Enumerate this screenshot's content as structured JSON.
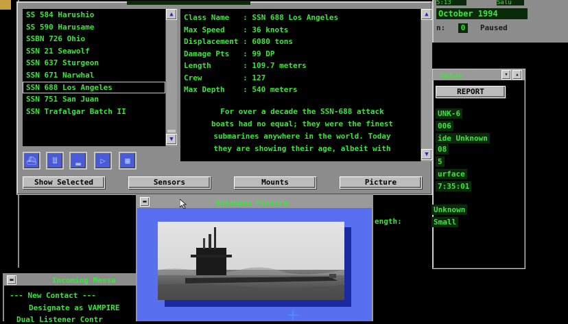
{
  "top_right": {
    "date": "October 1994",
    "speed_label": "n:",
    "speed_value": "0",
    "status": "Paused",
    "partial_time": "5:13",
    "partial_text": "Salu"
  },
  "database": {
    "ship_list": [
      "SS 584 Harushio",
      "SS 590 Harusame",
      "SSBN 726 Ohio",
      "SSN 21 Seawolf",
      "SSN 637 Sturgeon",
      "SSN 671 Narwhal",
      "SSN 688 Los Angeles",
      "SSN 751 San Juan",
      "SSN Trafalgar Batch II"
    ],
    "selected_index": 6,
    "info": [
      "Class Name   : SSN 688 Los Angeles",
      "Max Speed    : 36 knots",
      "Displacement : 6080 tons",
      "Damage Pts   : 99 DP",
      "Length       : 109.7 meters",
      "Crew         : 127",
      "Max Depth    : 540 meters"
    ],
    "description": [
      "For over a decade the SSN-688 attack",
      "boats had no equal; they were the finest",
      "submarines anywhere in the world.  Today",
      "they are showing their age, albeit with"
    ],
    "buttons": {
      "show_selected": "Show Selected",
      "sensors": "Sensors",
      "mounts": "Mounts",
      "picture": "Picture"
    }
  },
  "status_panel": {
    "title": "tatus",
    "report_button": "REPORT",
    "values": [
      "UNK-6",
      "006",
      "ide Unknown",
      "08",
      "5",
      "urface",
      "7:35:01"
    ],
    "label_ength": "ength:",
    "unknown": "Unknown",
    "small": "Small"
  },
  "picture_window": {
    "title": "Database Picture"
  },
  "messages": {
    "title": "Incoming Messa",
    "lines": [
      "--- New Contact ---",
      "Designate as VAMPIRE",
      "Dual Listener Contr"
    ]
  },
  "colors": {
    "green": "#38e838",
    "frame_gray": "#8c8c8c",
    "picture_blue": "#5870f0"
  }
}
